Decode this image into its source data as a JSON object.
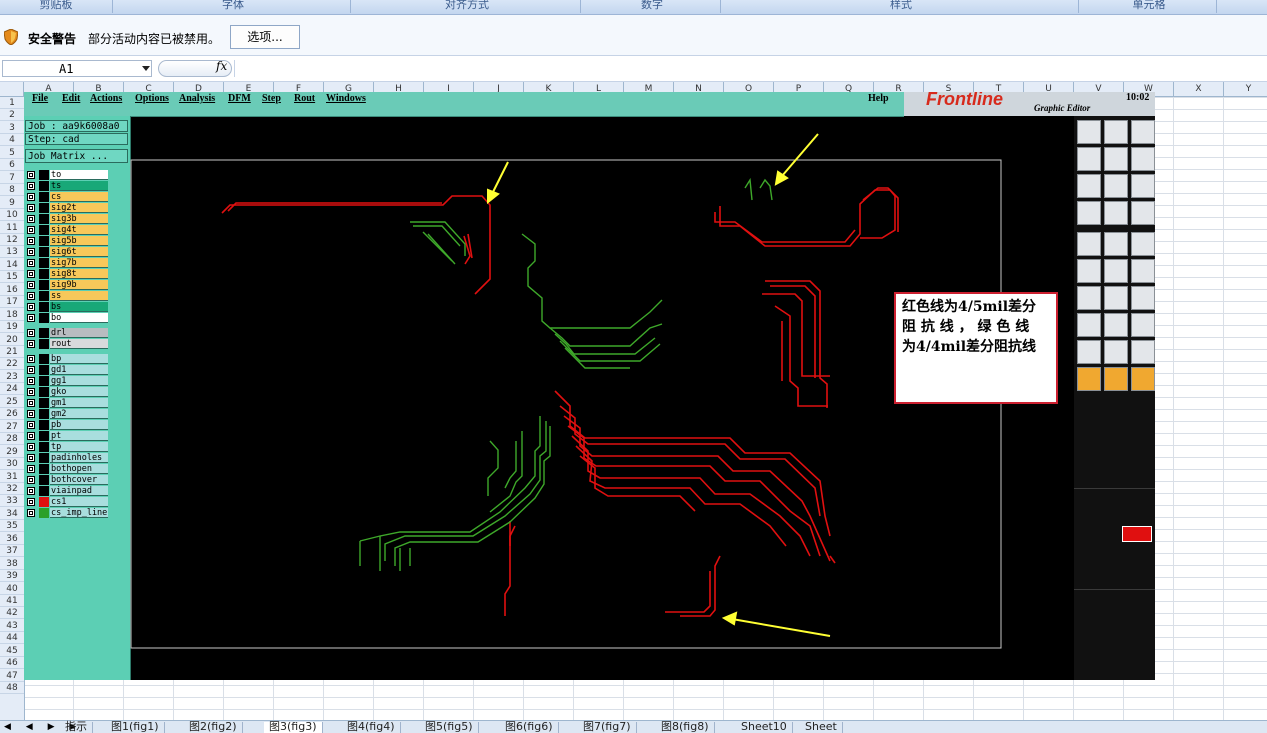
{
  "ribbon": {
    "groups": [
      "剪贴板",
      "字体",
      "对齐方式",
      "数字",
      "样式",
      "单元格"
    ]
  },
  "security": {
    "title": "安全警告",
    "message": "部分活动内容已被禁用。",
    "options_label": "选项..."
  },
  "formula_bar": {
    "cell_ref": "A1",
    "fx": "fx",
    "value": ""
  },
  "grid": {
    "columns": [
      "A",
      "B",
      "C",
      "D",
      "E",
      "F",
      "G",
      "H",
      "I",
      "J",
      "K",
      "L",
      "M",
      "N",
      "O",
      "P",
      "Q",
      "R",
      "S",
      "T",
      "U",
      "V",
      "W",
      "X",
      "Y"
    ],
    "rows": [
      "1",
      "2",
      "3",
      "4",
      "5",
      "6",
      "7",
      "8",
      "9",
      "10",
      "11",
      "12",
      "13",
      "14",
      "15",
      "16",
      "17",
      "18",
      "19",
      "20",
      "21",
      "22",
      "23",
      "24",
      "25",
      "26",
      "27",
      "28",
      "29",
      "30",
      "31",
      "32",
      "33",
      "34",
      "35",
      "36",
      "37",
      "38",
      "39",
      "40",
      "41",
      "42",
      "43",
      "44",
      "45",
      "46",
      "47",
      "48"
    ]
  },
  "sheet_tabs": {
    "nav": "◀ ◀ ▶ ▶",
    "tabs": [
      "指示",
      "图1(fig1)",
      "图2(fig2)",
      "图3(fig3)",
      "图4(fig4)",
      "图5(fig5)",
      "图6(fig6)",
      "图7(fig7)",
      "图8(fig8)",
      "Sheet10",
      "Sheet"
    ],
    "active_index": 3
  },
  "cad": {
    "menu": [
      "File",
      "Edit",
      "Actions",
      "Options",
      "Analysis",
      "DFM",
      "Step",
      "Rout",
      "Windows"
    ],
    "help": "Help",
    "logo": "Frontline",
    "logo_sub": "Graphic Editor",
    "time": "10:02",
    "job": "Job : aa9k6008a0",
    "step": "Step: cad",
    "job_matrix": "Job Matrix ...",
    "layers": [
      {
        "name": "to",
        "color": "#ffffff"
      },
      {
        "name": "ts",
        "color": "#18a878"
      },
      {
        "name": "cs",
        "color": "#f7c85a"
      },
      {
        "name": "sig2t",
        "color": "#f7c85a"
      },
      {
        "name": "sig3b",
        "color": "#f7c85a"
      },
      {
        "name": "sig4t",
        "color": "#f7c85a"
      },
      {
        "name": "sig5b",
        "color": "#f7c85a"
      },
      {
        "name": "sig6t",
        "color": "#f7c85a"
      },
      {
        "name": "sig7b",
        "color": "#f7c85a"
      },
      {
        "name": "sig8t",
        "color": "#f7c85a"
      },
      {
        "name": "sig9b",
        "color": "#f7c85a"
      },
      {
        "name": "ss",
        "color": "#f7c85a"
      },
      {
        "name": "bs",
        "color": "#18a878"
      },
      {
        "name": "bo",
        "color": "#ffffff"
      },
      {
        "name": "drl",
        "color": "#b8bcc0"
      },
      {
        "name": "rout",
        "color": "#d8dadc"
      },
      {
        "name": "bp",
        "color": "#a9dede"
      },
      {
        "name": "gd1",
        "color": "#a9dede"
      },
      {
        "name": "gg1",
        "color": "#a9dede"
      },
      {
        "name": "gko",
        "color": "#a9dede"
      },
      {
        "name": "gm1",
        "color": "#a9dede"
      },
      {
        "name": "gm2",
        "color": "#a9dede"
      },
      {
        "name": "pb",
        "color": "#a9dede"
      },
      {
        "name": "pt",
        "color": "#a9dede"
      },
      {
        "name": "tp",
        "color": "#a9dede"
      },
      {
        "name": "padinholes",
        "color": "#a9dede"
      },
      {
        "name": "bothopen",
        "color": "#a9dede"
      },
      {
        "name": "bothcover",
        "color": "#a9dede"
      },
      {
        "name": "viainpad",
        "color": "#a9dede"
      },
      {
        "name": "cs1",
        "color": "#a9dede",
        "swatch": "#e01010"
      },
      {
        "name": "cs_imp_line",
        "color": "#a9dede",
        "swatch": "#2aa02a"
      }
    ],
    "note": {
      "line1": "红色线为4/5mil差分",
      "line2": "阻 抗 线 ， 绿 色 线",
      "line3": "为4/4mil差分阻抗线"
    },
    "colors": {
      "red_trace": "#e01010",
      "green_trace": "#3ea82a",
      "arrow": "#ffff33"
    }
  }
}
